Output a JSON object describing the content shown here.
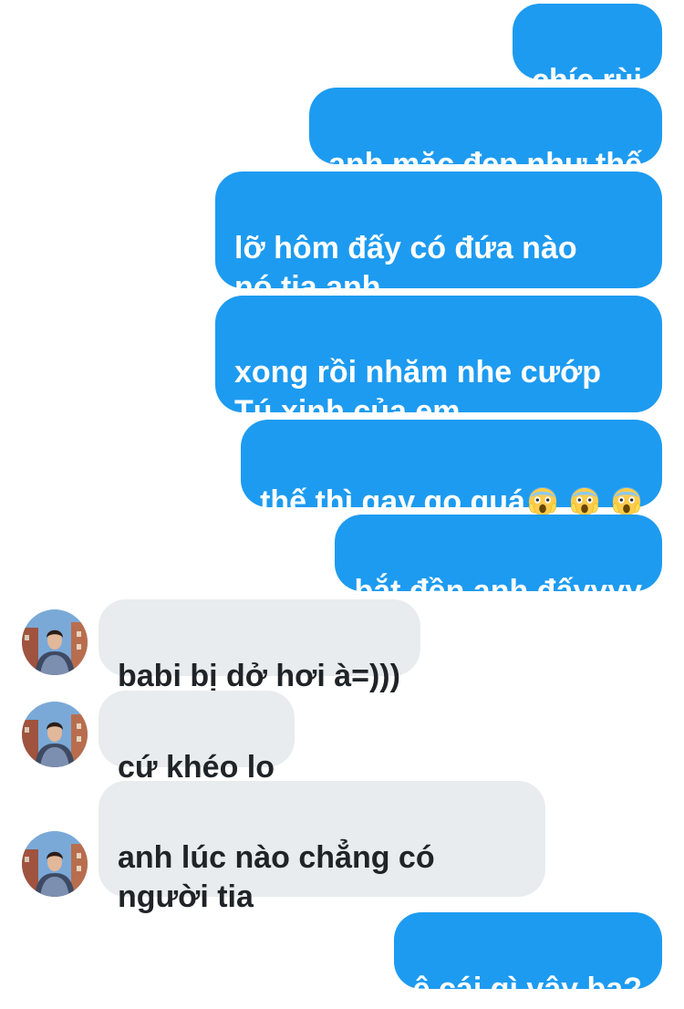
{
  "messages": [
    {
      "direction": "outgoing",
      "text": "chíc rùi"
    },
    {
      "direction": "outgoing",
      "text": "anh mặc đẹp như thế"
    },
    {
      "direction": "outgoing",
      "text": "lỡ hôm đấy có đứa nào\nnó tia anh"
    },
    {
      "direction": "outgoing",
      "text": "xong rồi nhăm nhe cướp\nTú xinh của em"
    },
    {
      "direction": "outgoing",
      "text": "thế thì gay go quá",
      "emoji": [
        "face-screaming-in-fear-icon",
        "face-screaming-in-fear-icon",
        "face-screaming-in-fear-icon"
      ]
    },
    {
      "direction": "outgoing",
      "text": "bắt đền anh đấyyyy"
    },
    {
      "direction": "incoming",
      "text": "babi bị dở hơi à=)))"
    },
    {
      "direction": "incoming",
      "text": "cứ khéo lo"
    },
    {
      "direction": "incoming",
      "text": "anh lúc nào chẳng có\nngười tia"
    },
    {
      "direction": "outgoing",
      "text": "ê cái gì vậy ba?"
    }
  ],
  "colors": {
    "outgoing_bubble": "#1d9bf0",
    "outgoing_text": "#ffffff",
    "incoming_bubble": "#e8ecef",
    "incoming_text": "#202428"
  }
}
